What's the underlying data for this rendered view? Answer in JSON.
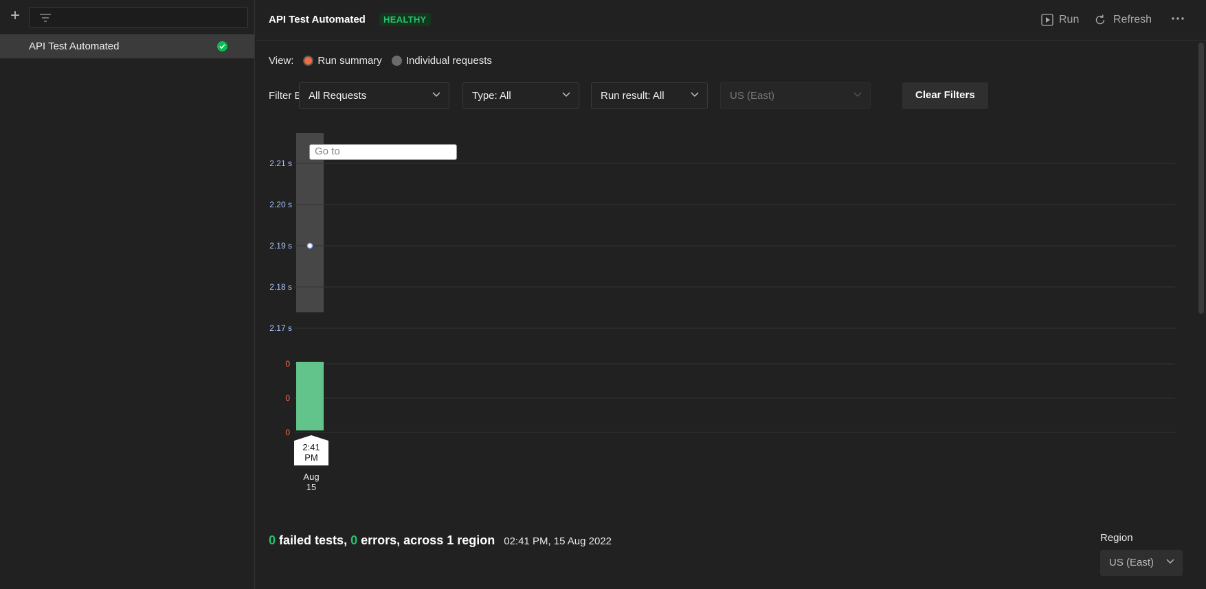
{
  "sidebar": {
    "item": {
      "label": "API Test Automated",
      "status": "passed"
    }
  },
  "header": {
    "title": "API Test Automated",
    "badge": "HEALTHY",
    "run_label": "Run",
    "refresh_label": "Refresh"
  },
  "view": {
    "label": "View:",
    "options": [
      "Run summary",
      "Individual requests"
    ],
    "selected": "Run summary"
  },
  "filters": {
    "label": "Filter By:",
    "requests": "All Requests",
    "type": "Type: All",
    "run_result": "Run result: All",
    "region": "US (East)",
    "clear_label": "Clear Filters"
  },
  "chart_data": {
    "type": "bar",
    "goto_placeholder": "Go to",
    "response_time_axis": {
      "ticks": [
        "2.21 s",
        "2.20 s",
        "2.19 s",
        "2.18 s",
        "2.17 s"
      ],
      "ylim": [
        2.17,
        2.21
      ]
    },
    "failure_axis": {
      "ticks": [
        "0",
        "0",
        "0"
      ]
    },
    "categories": [
      "Aug 15 2:41 PM"
    ],
    "series": [
      {
        "values": [
          2.19
        ]
      },
      {
        "values": [
          0
        ]
      }
    ],
    "time_label": [
      "2:41",
      "PM"
    ],
    "date_label": [
      "Aug",
      "15"
    ],
    "colors": {
      "response": "#a7c4ff",
      "failures": "#ff6b4a",
      "bar": "#62c48a"
    }
  },
  "summary": {
    "failed_count": "0",
    "failed_text": "failed tests,",
    "error_count": "0",
    "error_text": "errors, across 1 region",
    "timestamp": "02:41 PM, 15 Aug 2022"
  },
  "region": {
    "label": "Region",
    "value": "US (East)"
  }
}
